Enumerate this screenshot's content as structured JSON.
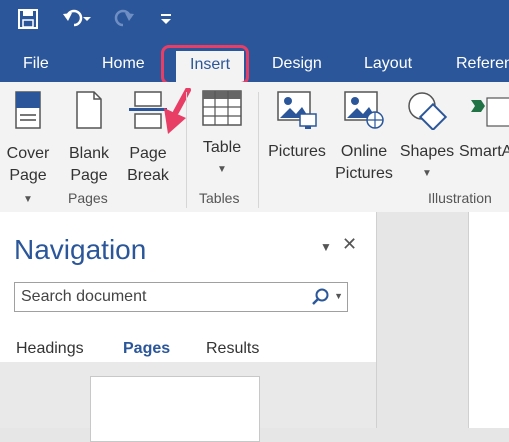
{
  "quick_access": {
    "save_icon": "save-icon",
    "undo_icon": "undo-icon",
    "redo_icon": "redo-icon",
    "customize_icon": "customize-qat-icon"
  },
  "menu": {
    "tabs": [
      "File",
      "Home",
      "Insert",
      "Design",
      "Layout",
      "Referen"
    ],
    "active": "Insert"
  },
  "ribbon": {
    "cover_page": [
      "Cover",
      "Page"
    ],
    "blank_page": [
      "Blank",
      "Page"
    ],
    "page_break": [
      "Page",
      "Break"
    ],
    "table": "Table",
    "pictures": "Pictures",
    "online_pictures": [
      "Online",
      "Pictures"
    ],
    "shapes": "Shapes",
    "smartart": "SmartA",
    "groups": {
      "pages": "Pages",
      "tables": "Tables",
      "illustrations": "Illustration"
    }
  },
  "navigation": {
    "title": "Navigation",
    "search_placeholder": "Search document",
    "tabs": [
      "Headings",
      "Pages",
      "Results"
    ],
    "selected_tab": "Pages"
  },
  "colors": {
    "brand": "#2b579a",
    "highlight": "#e83e66"
  }
}
